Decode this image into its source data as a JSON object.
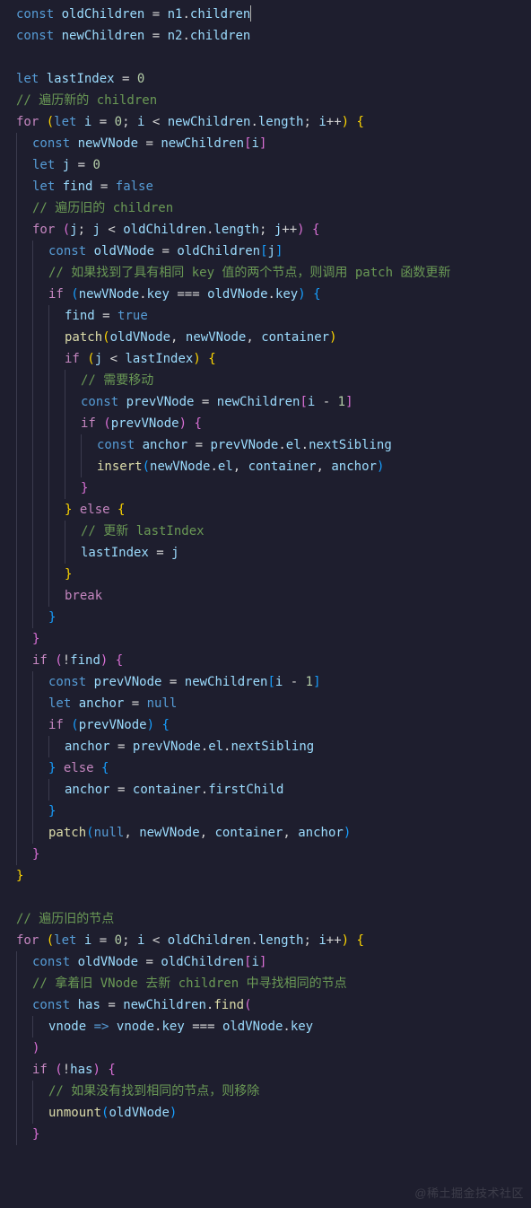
{
  "watermark": "@稀土掘金技术社区",
  "lines": [
    {
      "i": 0,
      "h": "<span class='kw2'>const</span> <span class='var'>oldChildren</span> <span class='op'>=</span> <span class='var'>n1</span><span class='dot'>.</span><span class='prop'>children</span><span class='cursor'></span>"
    },
    {
      "i": 0,
      "h": "<span class='kw2'>const</span> <span class='var'>newChildren</span> <span class='op'>=</span> <span class='var'>n2</span><span class='dot'>.</span><span class='prop'>children</span>"
    },
    {
      "i": 0,
      "h": "&nbsp;"
    },
    {
      "i": 0,
      "h": "<span class='kw2'>let</span> <span class='var'>lastIndex</span> <span class='op'>=</span> <span class='num'>0</span>"
    },
    {
      "i": 0,
      "h": "<span class='cmt'>// 遍历新的 children</span>"
    },
    {
      "i": 0,
      "h": "<span class='kw'>for</span> <span class='br-y'>(</span><span class='kw2'>let</span> <span class='var'>i</span> <span class='op'>=</span> <span class='num'>0</span><span class='pn'>;</span> <span class='var'>i</span> <span class='op'>&lt;</span> <span class='var'>newChildren</span><span class='dot'>.</span><span class='prop'>length</span><span class='pn'>;</span> <span class='var'>i</span><span class='op'>++</span><span class='br-y'>)</span> <span class='br-y'>{</span>"
    },
    {
      "i": 1,
      "h": "<span class='kw2'>const</span> <span class='var'>newVNode</span> <span class='op'>=</span> <span class='var'>newChildren</span><span class='br-p'>[</span><span class='var'>i</span><span class='br-p'>]</span>"
    },
    {
      "i": 1,
      "h": "<span class='kw2'>let</span> <span class='var'>j</span> <span class='op'>=</span> <span class='num'>0</span>"
    },
    {
      "i": 1,
      "h": "<span class='kw2'>let</span> <span class='var'>find</span> <span class='op'>=</span> <span class='bool'>false</span>"
    },
    {
      "i": 1,
      "h": "<span class='cmt'>// 遍历旧的 children</span>"
    },
    {
      "i": 1,
      "h": "<span class='kw'>for</span> <span class='br-p'>(</span><span class='var'>j</span><span class='pn'>;</span> <span class='var'>j</span> <span class='op'>&lt;</span> <span class='var'>oldChildren</span><span class='dot'>.</span><span class='prop'>length</span><span class='pn'>;</span> <span class='var'>j</span><span class='op'>++</span><span class='br-p'>)</span> <span class='br-p'>{</span>"
    },
    {
      "i": 2,
      "h": "<span class='kw2'>const</span> <span class='var'>oldVNode</span> <span class='op'>=</span> <span class='var'>oldChildren</span><span class='br-b'>[</span><span class='var'>j</span><span class='br-b'>]</span>"
    },
    {
      "i": 2,
      "h": "<span class='cmt'>// 如果找到了具有相同 key 值的两个节点，则调用 patch 函数更新</span>"
    },
    {
      "i": 2,
      "h": "<span class='kw'>if</span> <span class='br-b'>(</span><span class='var'>newVNode</span><span class='dot'>.</span><span class='prop'>key</span> <span class='op'>===</span> <span class='var'>oldVNode</span><span class='dot'>.</span><span class='prop'>key</span><span class='br-b'>)</span> <span class='br-b'>{</span>"
    },
    {
      "i": 3,
      "h": "<span class='var'>find</span> <span class='op'>=</span> <span class='bool'>true</span>"
    },
    {
      "i": 3,
      "h": "<span class='fn'>patch</span><span class='br-y'>(</span><span class='var'>oldVNode</span><span class='pn'>,</span> <span class='var'>newVNode</span><span class='pn'>,</span> <span class='var'>container</span><span class='br-y'>)</span>"
    },
    {
      "i": 3,
      "h": "<span class='kw'>if</span> <span class='br-y'>(</span><span class='var'>j</span> <span class='op'>&lt;</span> <span class='var'>lastIndex</span><span class='br-y'>)</span> <span class='br-y'>{</span>"
    },
    {
      "i": 4,
      "h": "<span class='cmt'>// 需要移动</span>"
    },
    {
      "i": 4,
      "h": "<span class='kw2'>const</span> <span class='var'>prevVNode</span> <span class='op'>=</span> <span class='var'>newChildren</span><span class='br-p'>[</span><span class='var'>i</span> <span class='op'>-</span> <span class='num'>1</span><span class='br-p'>]</span>"
    },
    {
      "i": 4,
      "h": "<span class='kw'>if</span> <span class='br-p'>(</span><span class='var'>prevVNode</span><span class='br-p'>)</span> <span class='br-p'>{</span>"
    },
    {
      "i": 5,
      "h": "<span class='kw2'>const</span> <span class='var'>anchor</span> <span class='op'>=</span> <span class='var'>prevVNode</span><span class='dot'>.</span><span class='prop'>el</span><span class='dot'>.</span><span class='prop'>nextSibling</span>"
    },
    {
      "i": 5,
      "h": "<span class='fn'>insert</span><span class='br-b'>(</span><span class='var'>newVNode</span><span class='dot'>.</span><span class='prop'>el</span><span class='pn'>,</span> <span class='var'>container</span><span class='pn'>,</span> <span class='var'>anchor</span><span class='br-b'>)</span>"
    },
    {
      "i": 4,
      "h": "<span class='br-p'>}</span>"
    },
    {
      "i": 3,
      "h": "<span class='br-y'>}</span> <span class='kw'>else</span> <span class='br-y'>{</span>"
    },
    {
      "i": 4,
      "h": "<span class='cmt'>// 更新 lastIndex</span>"
    },
    {
      "i": 4,
      "h": "<span class='var'>lastIndex</span> <span class='op'>=</span> <span class='var'>j</span>"
    },
    {
      "i": 3,
      "h": "<span class='br-y'>}</span>"
    },
    {
      "i": 3,
      "h": "<span class='kw'>break</span>"
    },
    {
      "i": 2,
      "h": "<span class='br-b'>}</span>"
    },
    {
      "i": 1,
      "h": "<span class='br-p'>}</span>"
    },
    {
      "i": 1,
      "h": "<span class='kw'>if</span> <span class='br-p'>(</span><span class='op'>!</span><span class='var'>find</span><span class='br-p'>)</span> <span class='br-p'>{</span>"
    },
    {
      "i": 2,
      "h": "<span class='kw2'>const</span> <span class='var'>prevVNode</span> <span class='op'>=</span> <span class='var'>newChildren</span><span class='br-b'>[</span><span class='var'>i</span> <span class='op'>-</span> <span class='num'>1</span><span class='br-b'>]</span>"
    },
    {
      "i": 2,
      "h": "<span class='kw2'>let</span> <span class='var'>anchor</span> <span class='op'>=</span> <span class='null'>null</span>"
    },
    {
      "i": 2,
      "h": "<span class='kw'>if</span> <span class='br-b'>(</span><span class='var'>prevVNode</span><span class='br-b'>)</span> <span class='br-b'>{</span>"
    },
    {
      "i": 3,
      "h": "<span class='var'>anchor</span> <span class='op'>=</span> <span class='var'>prevVNode</span><span class='dot'>.</span><span class='prop'>el</span><span class='dot'>.</span><span class='prop'>nextSibling</span>"
    },
    {
      "i": 2,
      "h": "<span class='br-b'>}</span> <span class='kw'>else</span> <span class='br-b'>{</span>"
    },
    {
      "i": 3,
      "h": "<span class='var'>anchor</span> <span class='op'>=</span> <span class='var'>container</span><span class='dot'>.</span><span class='prop'>firstChild</span>"
    },
    {
      "i": 2,
      "h": "<span class='br-b'>}</span>"
    },
    {
      "i": 2,
      "h": "<span class='fn'>patch</span><span class='br-b'>(</span><span class='null'>null</span><span class='pn'>,</span> <span class='var'>newVNode</span><span class='pn'>,</span> <span class='var'>container</span><span class='pn'>,</span> <span class='var'>anchor</span><span class='br-b'>)</span>"
    },
    {
      "i": 1,
      "h": "<span class='br-p'>}</span>"
    },
    {
      "i": 0,
      "h": "<span class='br-y'>}</span>"
    },
    {
      "i": 0,
      "h": "&nbsp;"
    },
    {
      "i": 0,
      "h": "<span class='cmt'>// 遍历旧的节点</span>"
    },
    {
      "i": 0,
      "h": "<span class='kw'>for</span> <span class='br-y'>(</span><span class='kw2'>let</span> <span class='var'>i</span> <span class='op'>=</span> <span class='num'>0</span><span class='pn'>;</span> <span class='var'>i</span> <span class='op'>&lt;</span> <span class='var'>oldChildren</span><span class='dot'>.</span><span class='prop'>length</span><span class='pn'>;</span> <span class='var'>i</span><span class='op'>++</span><span class='br-y'>)</span> <span class='br-y'>{</span>"
    },
    {
      "i": 1,
      "h": "<span class='kw2'>const</span> <span class='var'>oldVNode</span> <span class='op'>=</span> <span class='var'>oldChildren</span><span class='br-p'>[</span><span class='var'>i</span><span class='br-p'>]</span>"
    },
    {
      "i": 1,
      "h": "<span class='cmt'>// 拿着旧 VNode 去新 children 中寻找相同的节点</span>"
    },
    {
      "i": 1,
      "h": "<span class='kw2'>const</span> <span class='var'>has</span> <span class='op'>=</span> <span class='var'>newChildren</span><span class='dot'>.</span><span class='fn'>find</span><span class='br-p'>(</span>"
    },
    {
      "i": 2,
      "h": "<span class='var'>vnode</span> <span class='kw2'>=&gt;</span> <span class='var'>vnode</span><span class='dot'>.</span><span class='prop'>key</span> <span class='op'>===</span> <span class='var'>oldVNode</span><span class='dot'>.</span><span class='prop'>key</span>"
    },
    {
      "i": 1,
      "h": "<span class='br-p'>)</span>"
    },
    {
      "i": 1,
      "h": "<span class='kw'>if</span> <span class='br-p'>(</span><span class='op'>!</span><span class='var'>has</span><span class='br-p'>)</span> <span class='br-p'>{</span>"
    },
    {
      "i": 2,
      "h": "<span class='cmt'>// 如果没有找到相同的节点，则移除</span>"
    },
    {
      "i": 2,
      "h": "<span class='fn'>unmount</span><span class='br-b'>(</span><span class='var'>oldVNode</span><span class='br-b'>)</span>"
    },
    {
      "i": 1,
      "h": "<span class='br-p'>}</span>"
    }
  ]
}
